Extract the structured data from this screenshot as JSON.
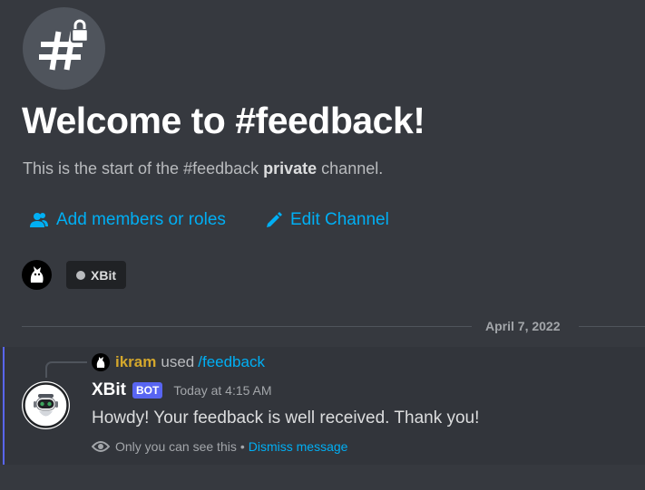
{
  "welcome": {
    "title": "Welcome to #feedback!",
    "subtitle_prefix": "This is the start of the #feedback ",
    "subtitle_bold": "private",
    "subtitle_suffix": " channel."
  },
  "actions": {
    "add_members": "Add members or roles",
    "edit_channel": "Edit Channel"
  },
  "member_chip": {
    "name": "XBit"
  },
  "divider": {
    "date": "April 7, 2022"
  },
  "message": {
    "reply_user": "ikram",
    "reply_used": "used",
    "reply_command": "/feedback",
    "author": "XBit",
    "bot_tag": "BOT",
    "timestamp": "Today at 4:15 AM",
    "content": "Howdy! Your feedback is well received. Thank you!",
    "ephemeral_note": "Only you can see this",
    "separator": "•",
    "dismiss_label": "Dismiss message"
  },
  "icons": {
    "channel": "private-channel-hash-lock-icon",
    "add_members": "people-icon",
    "edit_channel": "pencil-icon",
    "ephemeral": "eye-icon"
  },
  "colors": {
    "background": "#36393f",
    "link": "#00aff4",
    "bot_tag": "#5865f2",
    "reply_user": "#d4a72c"
  }
}
